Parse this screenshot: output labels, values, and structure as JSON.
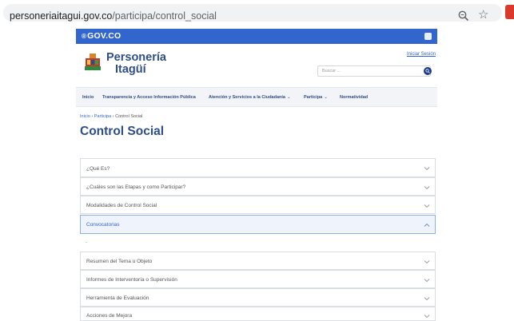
{
  "browser": {
    "url_host": "personeriaitagui.gov.co",
    "url_path": "/participa/control_social"
  },
  "govbar": {
    "logo": "GOV.CO"
  },
  "header": {
    "logo_line1": "Personería",
    "logo_line2": "Itagüí",
    "login_link": "Iniciar Sesión",
    "search_placeholder": "Buscar ..."
  },
  "nav": {
    "items": [
      {
        "label": "Inicio",
        "has_dropdown": false
      },
      {
        "label": "Transparencia y Acceso Información Pública",
        "has_dropdown": false
      },
      {
        "label": "Atención y Servicios a la Ciudadanía",
        "has_dropdown": true
      },
      {
        "label": "Participa",
        "has_dropdown": true
      },
      {
        "label": "Normatividad",
        "has_dropdown": false
      }
    ]
  },
  "breadcrumb": {
    "items": [
      "Inicio",
      "Participa",
      "Control Social"
    ],
    "separator": "›"
  },
  "page_title": "Control Social",
  "accordion": {
    "items": [
      {
        "label": "¿Qué Es?",
        "expanded": false
      },
      {
        "label": "¿Cuáles son las Etapas y como Participar?",
        "expanded": false
      },
      {
        "label": "Modalidades de Control Social",
        "expanded": false
      },
      {
        "label": "Convocatorias",
        "expanded": true
      },
      {
        "label": "Resumen del Tema u Objeto",
        "expanded": false
      },
      {
        "label": "Informes de Interventoría o Supervisión",
        "expanded": false
      },
      {
        "label": "Herramienta de Evaluación",
        "expanded": false
      },
      {
        "label": "Acciones de Mejora",
        "expanded": false
      }
    ],
    "expanded_content": "-"
  },
  "colors": {
    "gov_blue": "#3366cc",
    "brand_navy": "#2f4e88",
    "expanded_bg": "#eef3fc"
  },
  "icons": {
    "zoom": "zoom-icon",
    "bookmark": "star-icon",
    "search": "search-icon",
    "chevron_down": "chevron-down-icon",
    "chevron_up": "chevron-up-icon"
  }
}
